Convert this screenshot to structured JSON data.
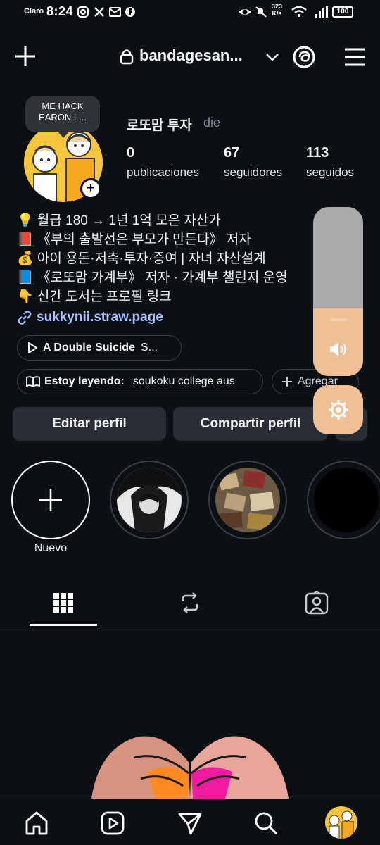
{
  "status_bar": {
    "carrier": "Claro",
    "time": "8:24",
    "net_speed": "323",
    "net_unit": "K/s",
    "battery": "100"
  },
  "header": {
    "username": "bandagesan...",
    "new_post_icon": "plus-icon",
    "threads_icon": "threads-icon",
    "menu_icon": "hamburger-menu-icon"
  },
  "profile": {
    "note": "ME HACK EARON L...",
    "display_name": "로또맘 투자",
    "pronouns": "die",
    "stats": [
      {
        "value": "0",
        "label": "publicaciones"
      },
      {
        "value": "67",
        "label": "seguidores"
      },
      {
        "value": "113",
        "label": "seguidos"
      }
    ],
    "bio": [
      "💡 월급 180 → 1년 1억 모은 자산가",
      "📕 《부의 출발선은 부모가 만든다》 저자",
      "💰 아이 용돈·저축·투자·증여 | 자녀 자산설계",
      "📘 《로또맘 가계부》 저자 · 가계부 챌린지 운영",
      "👇 신간 도서는 프로필 링크"
    ],
    "link": "sukkynii.straw.page",
    "music": "A Double Suicide",
    "music_tail": "S...",
    "reading_label": "Estoy leyendo:",
    "reading_value": "soukoku college aus",
    "add_label": "Agregar"
  },
  "buttons": {
    "edit": "Editar perfil",
    "share": "Compartir perfil"
  },
  "highlights": {
    "new_label": "Nuevo"
  },
  "volume": {
    "level": 0.4,
    "icon": "speaker-icon",
    "settings_icon": "gear-icon"
  },
  "colors": {
    "background": "#0c0f14",
    "button": "#2a2d33",
    "link": "#a6c4ff",
    "volume_fill": "#efbf96"
  }
}
